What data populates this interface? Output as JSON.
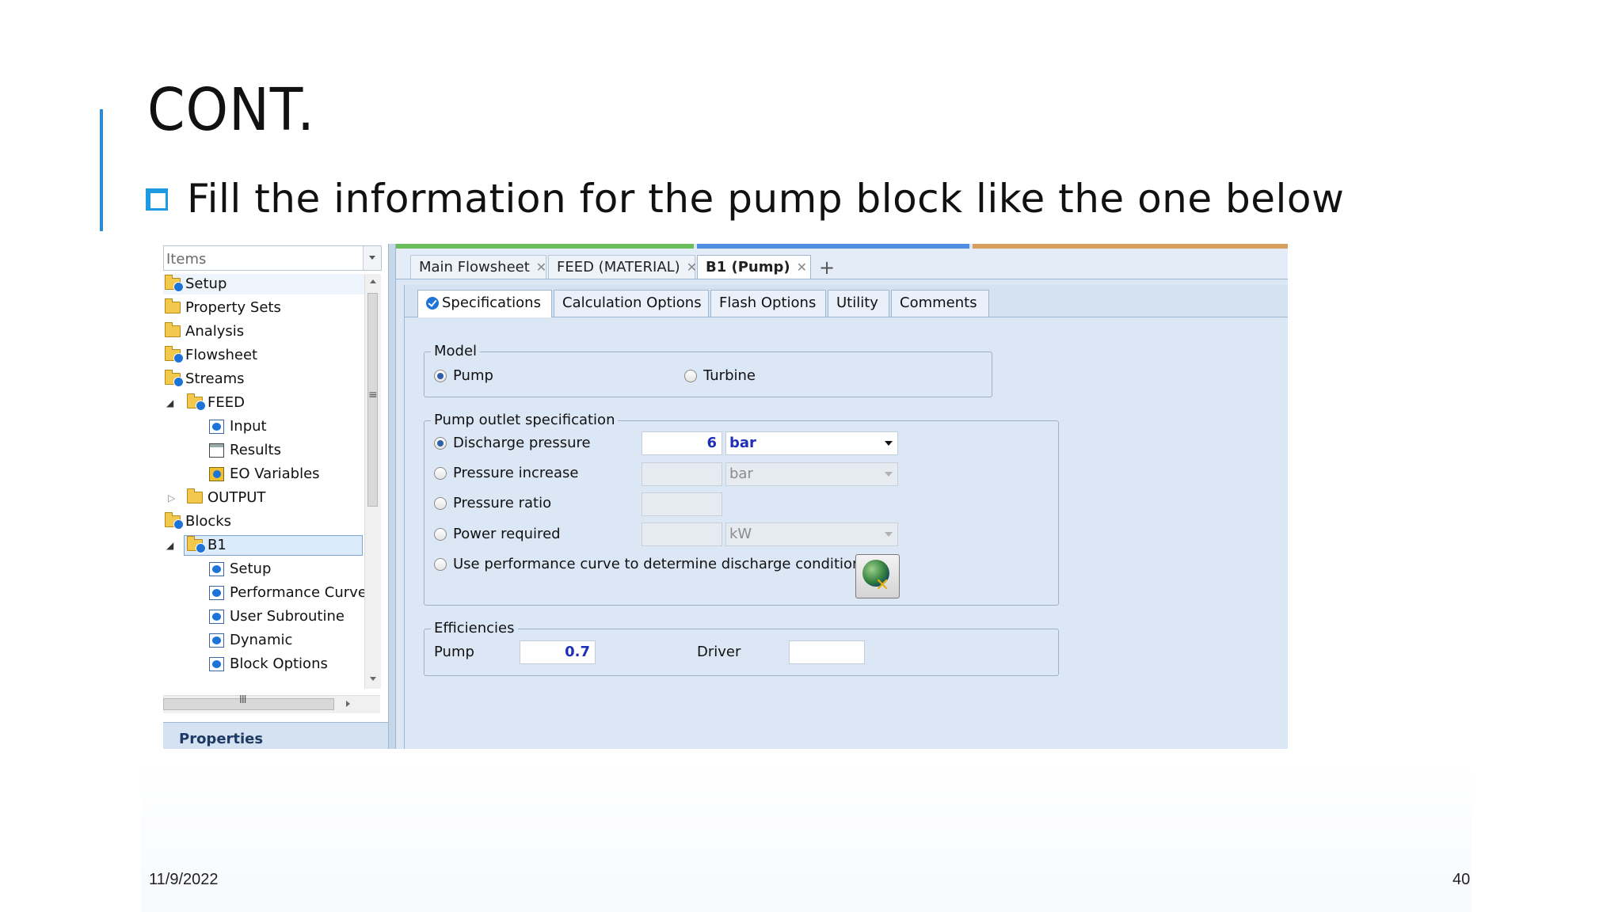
{
  "slide": {
    "title": "CONT.",
    "bullet": "Fill the information for the pump block like the one below",
    "date": "11/9/2022",
    "page_number": "40"
  },
  "left_pane": {
    "items_placeholder": "Items",
    "tree": [
      {
        "label": "Setup",
        "icon": "folder-check-icon"
      },
      {
        "label": "Property Sets",
        "icon": "folder-icon"
      },
      {
        "label": "Analysis",
        "icon": "folder-icon"
      },
      {
        "label": "Flowsheet",
        "icon": "folder-check-icon"
      },
      {
        "label": "Streams",
        "icon": "folder-check-icon"
      },
      {
        "label": "FEED",
        "icon": "folder-check-icon"
      },
      {
        "label": "Input",
        "icon": "form-check-icon"
      },
      {
        "label": "Results",
        "icon": "results-icon"
      },
      {
        "label": "EO Variables",
        "icon": "eo-variables-icon"
      },
      {
        "label": "OUTPUT",
        "icon": "folder-icon"
      },
      {
        "label": "Blocks",
        "icon": "folder-check-icon"
      },
      {
        "label": "B1",
        "icon": "folder-check-icon"
      },
      {
        "label": "Setup",
        "icon": "form-check-icon"
      },
      {
        "label": "Performance Curve",
        "icon": "form-check-icon"
      },
      {
        "label": "User Subroutine",
        "icon": "form-check-icon"
      },
      {
        "label": "Dynamic",
        "icon": "form-check-icon"
      },
      {
        "label": "Block Options",
        "icon": "form-check-icon"
      }
    ],
    "properties_label": "Properties"
  },
  "doc_tabs": [
    {
      "label": "Main Flowsheet"
    },
    {
      "label": "FEED (MATERIAL)"
    },
    {
      "label": "B1 (Pump)",
      "active": true
    }
  ],
  "sub_tabs": [
    "Specifications",
    "Calculation Options",
    "Flash Options",
    "Utility",
    "Comments"
  ],
  "model": {
    "title": "Model",
    "options": [
      "Pump",
      "Turbine"
    ],
    "selected": "Pump"
  },
  "outlet": {
    "title": "Pump outlet specification",
    "options": [
      {
        "label": "Discharge pressure",
        "value": "6",
        "unit": "bar",
        "selected": true
      },
      {
        "label": "Pressure increase",
        "value": "",
        "unit": "bar"
      },
      {
        "label": "Pressure ratio",
        "value": ""
      },
      {
        "label": "Power required",
        "value": "",
        "unit": "kW"
      },
      {
        "label": "Use performance curve to determine discharge conditions"
      }
    ]
  },
  "efficiencies": {
    "title": "Efficiencies",
    "pump_label": "Pump",
    "pump_value": "0.7",
    "driver_label": "Driver",
    "driver_value": ""
  },
  "colors": {
    "accent": "#2e8bd0",
    "bullet": "#1e9be0",
    "value_text": "#1f2fb8"
  }
}
